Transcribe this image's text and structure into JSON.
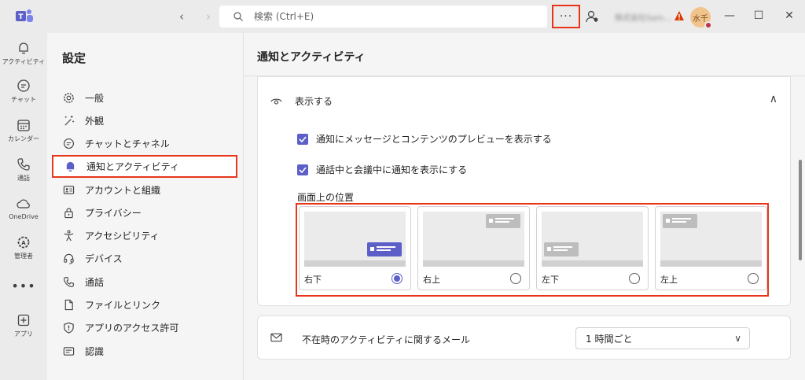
{
  "titlebar": {
    "search_placeholder": "検索 (Ctrl+E)",
    "more_label": "···",
    "avatar_initials": "水千",
    "org_name": "株式会社Sam..."
  },
  "rail": [
    {
      "label": "アクティビティ",
      "icon": "bell-icon"
    },
    {
      "label": "チャット",
      "icon": "chat-icon"
    },
    {
      "label": "カレンダー",
      "icon": "calendar-icon"
    },
    {
      "label": "通話",
      "icon": "phone-icon"
    },
    {
      "label": "OneDrive",
      "icon": "cloud-icon"
    },
    {
      "label": "管理者",
      "icon": "admin-icon"
    },
    {
      "label": "",
      "icon": "more-icon"
    },
    {
      "label": "アプリ",
      "icon": "add-app-icon"
    }
  ],
  "sidebar": {
    "title": "設定",
    "items": [
      {
        "label": "一般",
        "icon": "gear-icon"
      },
      {
        "label": "外観",
        "icon": "wand-icon"
      },
      {
        "label": "チャットとチャネル",
        "icon": "chat-icon"
      },
      {
        "label": "通知とアクティビティ",
        "icon": "bell-icon",
        "active": true
      },
      {
        "label": "アカウントと組織",
        "icon": "id-card-icon"
      },
      {
        "label": "プライバシー",
        "icon": "lock-icon"
      },
      {
        "label": "アクセシビリティ",
        "icon": "accessibility-icon"
      },
      {
        "label": "デバイス",
        "icon": "headset-icon"
      },
      {
        "label": "通話",
        "icon": "phone-icon"
      },
      {
        "label": "ファイルとリンク",
        "icon": "file-icon"
      },
      {
        "label": "アプリのアクセス許可",
        "icon": "shield-icon"
      },
      {
        "label": "認識",
        "icon": "recognition-icon"
      }
    ]
  },
  "main": {
    "title": "通知とアクティビティ",
    "display_section": {
      "heading": "表示する",
      "option_preview": "通知にメッセージとコンテンツのプレビューを表示する",
      "option_in_call": "通話中と会議中に通知を表示にする",
      "position_label": "画面上の位置",
      "positions": [
        {
          "label": "右下",
          "selected": true
        },
        {
          "label": "右上",
          "selected": false
        },
        {
          "label": "左下",
          "selected": false
        },
        {
          "label": "左上",
          "selected": false
        }
      ]
    },
    "email_section": {
      "label": "不在時のアクティビティに関するメール",
      "frequency": "1 時間ごと"
    }
  },
  "colors": {
    "accent": "#5b5fc7",
    "highlight": "#e8351a"
  }
}
